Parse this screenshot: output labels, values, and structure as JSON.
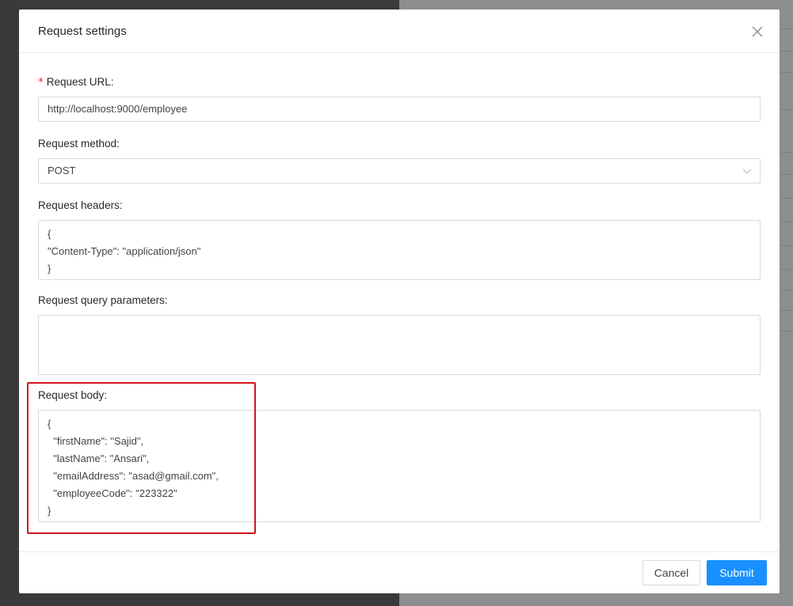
{
  "modal": {
    "title": "Request settings",
    "close_icon": "close-icon"
  },
  "form": {
    "url": {
      "label": "Request URL",
      "required_mark": "*",
      "value": "http://localhost:9000/employee"
    },
    "method": {
      "label": "Request method",
      "value": "POST",
      "arrow_icon": "chevron-down-icon"
    },
    "headers": {
      "label": "Request headers",
      "value": "{\n\"Content-Type\": \"application/json\"\n}"
    },
    "query": {
      "label": "Request query parameters",
      "value": ""
    },
    "body": {
      "label": "Request body",
      "value": "{\n  \"firstName\": \"Sajid\",\n  \"lastName\": \"Ansari\",\n  \"emailAddress\": \"asad@gmail.com\",\n  \"employeeCode\": \"223322\"\n}"
    },
    "label_suffix": ":"
  },
  "footer": {
    "cancel_label": "Cancel",
    "submit_label": "Submit"
  },
  "colors": {
    "primary": "#1890ff",
    "required": "#f5222d",
    "highlight": "#d0161b"
  }
}
